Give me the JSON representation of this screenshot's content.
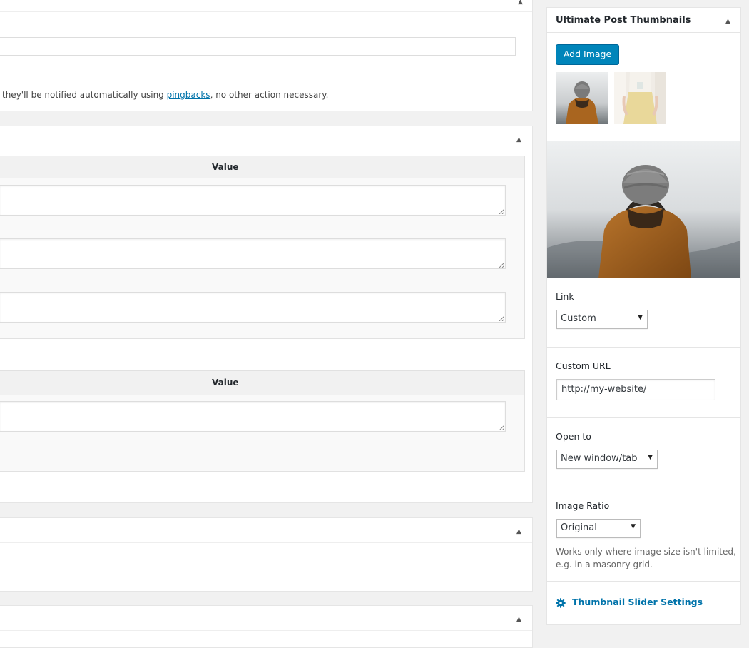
{
  "left_panel": {
    "discussion_text_before": "they'll be notified automatically using ",
    "discussion_link": "pingbacks",
    "discussion_text_after": ", no other action necessary.",
    "custom_fields_value_header_1": "Value",
    "custom_fields_value_header_2": "Value",
    "collapse_icon": "triangle-up-icon"
  },
  "sidebar": {
    "title": "Ultimate Post Thumbnails",
    "add_image_label": "Add Image",
    "thumbnails": [
      {
        "name": "person-hoodie-thumbnail"
      },
      {
        "name": "person-yellow-skirt-thumbnail"
      }
    ],
    "link": {
      "label": "Link",
      "selected": "Custom"
    },
    "custom_url": {
      "label": "Custom URL",
      "value": "http://my-website/"
    },
    "open_to": {
      "label": "Open to",
      "selected": "New window/tab"
    },
    "image_ratio": {
      "label": "Image Ratio",
      "selected": "Original",
      "help_line1": "Works only where image size isn't limited,",
      "help_line2": "e.g. in a masonry grid."
    },
    "settings_link": "Thumbnail Slider Settings",
    "colors": {
      "accent": "#0085ba",
      "link": "#0073aa"
    }
  }
}
